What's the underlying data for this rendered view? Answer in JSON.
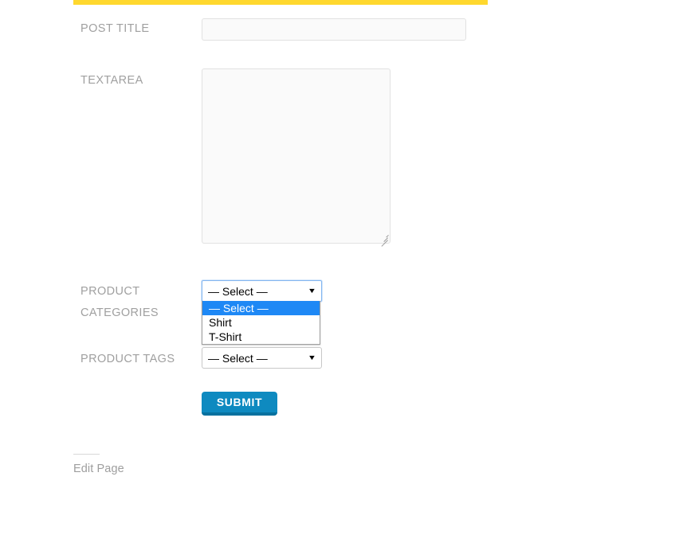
{
  "page": {
    "accent_color": "#ffd82e",
    "background": "#ffffff"
  },
  "form": {
    "fields": [
      {
        "label": "POST TITLE",
        "type": "text",
        "value": "",
        "placeholder": ""
      },
      {
        "label": "TEXTAREA",
        "type": "textarea",
        "value": "",
        "placeholder": ""
      },
      {
        "label_line1": "PRODUCT",
        "label_line2": "CATEGORIES",
        "label": "PRODUCT CATEGORIES",
        "type": "select",
        "value": "— Select —",
        "expanded": true,
        "options": [
          {
            "label": "— Select —",
            "selected": true
          },
          {
            "label": "Shirt",
            "selected": false
          },
          {
            "label": "T-Shirt",
            "selected": false
          }
        ]
      },
      {
        "label": "PRODUCT TAGS",
        "type": "select",
        "value": "— Select —",
        "expanded": false,
        "options": [
          {
            "label": "— Select —",
            "selected": true
          }
        ]
      }
    ],
    "submit_label": "SUBMIT",
    "caret_glyph": "▼"
  },
  "footer": {
    "edit_page_label": "Edit Page"
  },
  "colors": {
    "accent_yellow": "#ffd82e",
    "submit_blue": "#0e8ac0",
    "submit_blue_shadow": "#07719f",
    "dropdown_highlight": "#1e88f5",
    "label_gray": "#a0a0a0"
  }
}
